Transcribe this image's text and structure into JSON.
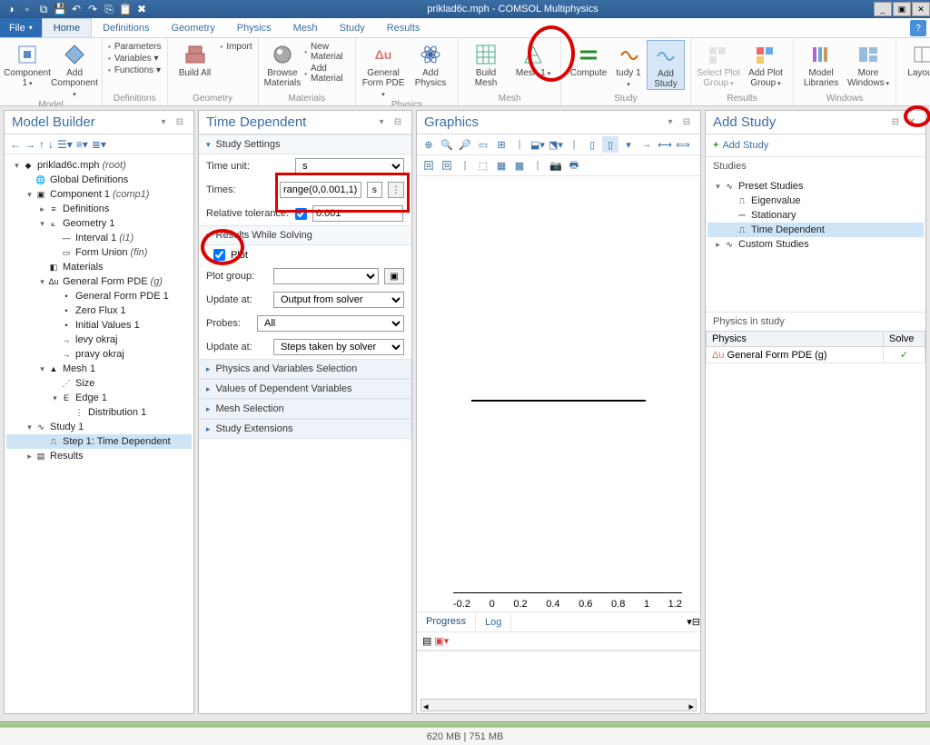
{
  "title": "priklad6c.mph - COMSOL Multiphysics",
  "file_menu": "File",
  "tabs": [
    "Home",
    "Definitions",
    "Geometry",
    "Physics",
    "Mesh",
    "Study",
    "Results"
  ],
  "active_tab": 0,
  "ribbon": {
    "groups": [
      {
        "label": "Model",
        "big": [
          {
            "name": "component",
            "label": "Component\n1",
            "dd": true
          },
          {
            "name": "add-component",
            "label": "Add\nComponent",
            "dd": true
          }
        ]
      },
      {
        "label": "Definitions",
        "list": [
          "Parameters",
          "Variables ▾",
          "Functions ▾"
        ]
      },
      {
        "label": "Geometry",
        "big": [
          {
            "name": "build-all",
            "label": "Build\nAll"
          }
        ],
        "list": [
          "Import"
        ]
      },
      {
        "label": "Materials",
        "big": [
          {
            "name": "browse-materials",
            "label": "Browse\nMaterials"
          }
        ],
        "list": [
          "New Material",
          "Add Material"
        ]
      },
      {
        "label": "Physics",
        "big": [
          {
            "name": "general-form-pde",
            "label": "General\nForm PDE",
            "dd": true
          },
          {
            "name": "add-physics",
            "label": "Add\nPhysics"
          }
        ]
      },
      {
        "label": "Mesh",
        "big": [
          {
            "name": "build-mesh",
            "label": "Build\nMesh"
          },
          {
            "name": "mesh-1",
            "label": "Mesh\n1",
            "dd": true
          }
        ]
      },
      {
        "label": "Study",
        "big": [
          {
            "name": "compute",
            "label": "Compute"
          },
          {
            "name": "study",
            "label": "tudy\n1",
            "dd": true
          },
          {
            "name": "add-study",
            "label": "Add\nStudy",
            "highlight": true
          }
        ]
      },
      {
        "label": "Results",
        "big": [
          {
            "name": "select-plot-group",
            "label": "Select Plot\nGroup",
            "dd": true,
            "disabled": true
          },
          {
            "name": "add-plot-group",
            "label": "Add Plot\nGroup",
            "dd": true
          }
        ]
      },
      {
        "label": "Windows",
        "big": [
          {
            "name": "model-libraries",
            "label": "Model\nLibraries"
          },
          {
            "name": "more-windows",
            "label": "More\nWindows",
            "dd": true
          }
        ]
      },
      {
        "label": "",
        "big": [
          {
            "name": "layout",
            "label": "Layout",
            "dd": true
          }
        ]
      }
    ]
  },
  "model_builder": {
    "title": "Model Builder",
    "tree": [
      {
        "d": 0,
        "exp": "▾",
        "ico": "◆",
        "label": "priklad6c.mph",
        "suffix": "(root)"
      },
      {
        "d": 1,
        "exp": "",
        "ico": "🌐",
        "label": "Global Definitions"
      },
      {
        "d": 1,
        "exp": "▾",
        "ico": "▣",
        "label": "Component 1",
        "suffix": "(comp1)"
      },
      {
        "d": 2,
        "exp": "▸",
        "ico": "≡",
        "label": "Definitions"
      },
      {
        "d": 2,
        "exp": "▾",
        "ico": "⟀",
        "label": "Geometry 1"
      },
      {
        "d": 3,
        "exp": "",
        "ico": "—",
        "label": "Interval 1",
        "suffix": "(i1)"
      },
      {
        "d": 3,
        "exp": "",
        "ico": "▭",
        "label": "Form Union",
        "suffix": "(fin)"
      },
      {
        "d": 2,
        "exp": "",
        "ico": "◧",
        "label": "Materials"
      },
      {
        "d": 2,
        "exp": "▾",
        "ico": "Δu",
        "label": "General Form PDE",
        "suffix": "(g)"
      },
      {
        "d": 3,
        "exp": "",
        "ico": "•",
        "label": "General Form PDE 1"
      },
      {
        "d": 3,
        "exp": "",
        "ico": "•",
        "label": "Zero Flux 1"
      },
      {
        "d": 3,
        "exp": "",
        "ico": "•",
        "label": "Initial Values 1"
      },
      {
        "d": 3,
        "exp": "",
        "ico": "→",
        "label": "levy okraj"
      },
      {
        "d": 3,
        "exp": "",
        "ico": "→",
        "label": "pravy okraj"
      },
      {
        "d": 2,
        "exp": "▾",
        "ico": "▲",
        "label": "Mesh 1"
      },
      {
        "d": 3,
        "exp": "",
        "ico": "⋰",
        "label": "Size"
      },
      {
        "d": 3,
        "exp": "▾",
        "ico": "E",
        "label": "Edge 1"
      },
      {
        "d": 4,
        "exp": "",
        "ico": "⋮",
        "label": "Distribution 1"
      },
      {
        "d": 1,
        "exp": "▾",
        "ico": "∿",
        "label": "Study 1"
      },
      {
        "d": 2,
        "exp": "",
        "ico": "⎍",
        "label": "Step 1: Time Dependent",
        "selected": true
      },
      {
        "d": 1,
        "exp": "▸",
        "ico": "▤",
        "label": "Results"
      }
    ]
  },
  "settings": {
    "title": "Time Dependent",
    "study_settings": "Study Settings",
    "time_unit_lbl": "Time unit:",
    "time_unit": "s",
    "times_lbl": "Times:",
    "times": "range(0,0.001,1)",
    "times_unit": "s",
    "rel_tol_lbl": "Relative tolerance:",
    "rel_tol_check": true,
    "rel_tol": "0.001",
    "rws": "Results While Solving",
    "plot_lbl": "Plot",
    "plot_check": true,
    "plot_group_lbl": "Plot group:",
    "update_at_lbl": "Update at:",
    "update_at": "Output from solver",
    "probes_lbl": "Probes:",
    "probes": "All",
    "update_at2": "Steps taken by solver",
    "collapsed": [
      "Physics and Variables Selection",
      "Values of Dependent Variables",
      "Mesh Selection",
      "Study Extensions"
    ]
  },
  "graphics": {
    "title": "Graphics",
    "ticks": [
      "-0.2",
      "0",
      "0.2",
      "0.4",
      "0.6",
      "0.8",
      "1",
      "1.2"
    ],
    "progress_tab": "Progress",
    "log_tab": "Log"
  },
  "add_study": {
    "title": "Add Study",
    "link": "Add Study",
    "studies_lbl": "Studies",
    "tree": [
      {
        "d": 0,
        "exp": "▾",
        "ico": "∿",
        "label": "Preset Studies"
      },
      {
        "d": 1,
        "exp": "",
        "ico": "⎍",
        "label": "Eigenvalue"
      },
      {
        "d": 1,
        "exp": "",
        "ico": "⎓",
        "label": "Stationary"
      },
      {
        "d": 1,
        "exp": "",
        "ico": "⎍",
        "label": "Time Dependent",
        "selected": true
      },
      {
        "d": 0,
        "exp": "▸",
        "ico": "∿",
        "label": "Custom Studies"
      }
    ],
    "phys_section": "Physics in study",
    "phys_headers": [
      "Physics",
      "Solve"
    ],
    "phys_rows": [
      {
        "name": "General Form PDE (g)",
        "solve": "✓"
      }
    ]
  },
  "status": "620 MB | 751 MB",
  "chart_data": {
    "type": "line",
    "x": [
      0,
      1
    ],
    "y": [
      0,
      0
    ],
    "xlim": [
      -0.2,
      1.2
    ],
    "xlabel": "",
    "ylabel": "",
    "title": "",
    "note": "single horizontal data segment rendered between x≈0.14 and x≈0.92 at mid-height"
  }
}
